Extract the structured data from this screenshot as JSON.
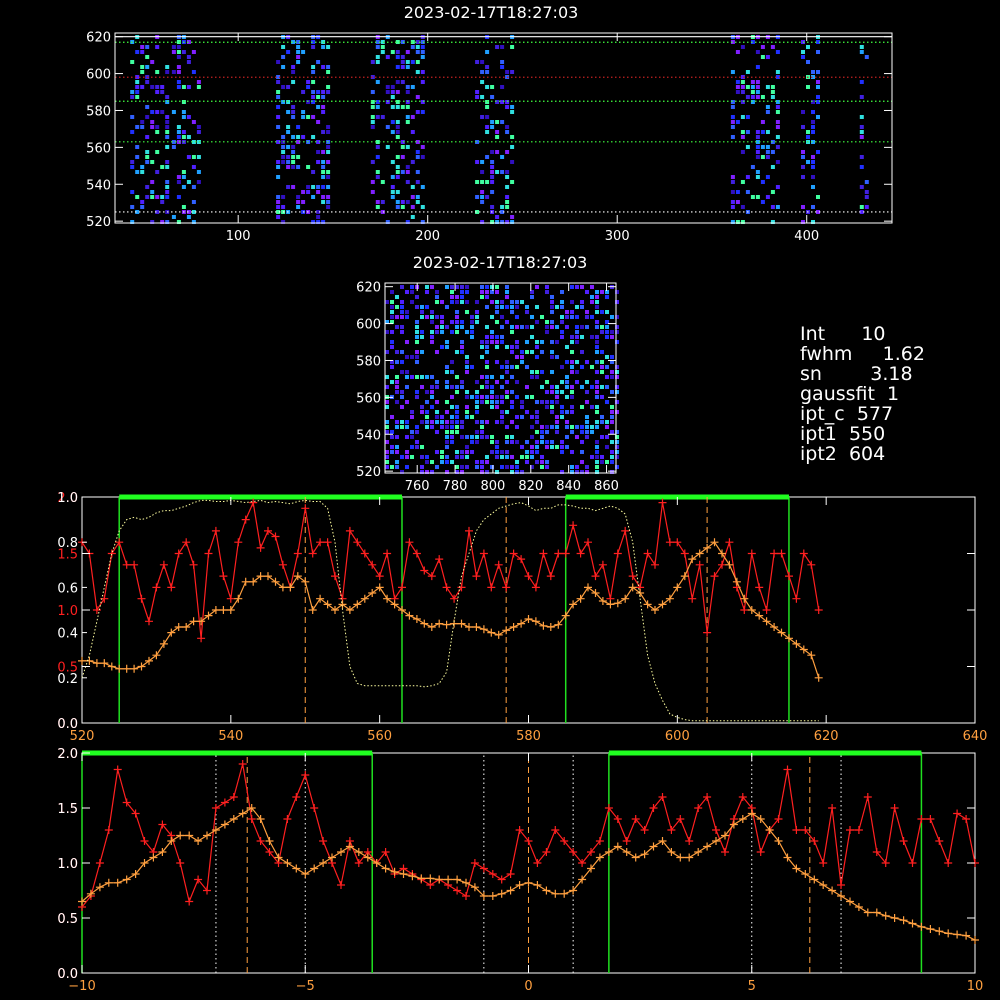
{
  "chart_data": [
    {
      "type": "heatmap",
      "title": "2023-02-17T18:27:03",
      "xlim": [
        35,
        445
      ],
      "ylim": [
        519,
        622
      ],
      "x_ticks": [
        100,
        200,
        300,
        400
      ],
      "y_ticks": [
        520,
        540,
        560,
        580,
        600,
        620
      ],
      "column_bands": [
        [
          43,
          62
        ],
        [
          65,
          80
        ],
        [
          120,
          147
        ],
        [
          170,
          198
        ],
        [
          225,
          245
        ],
        [
          360,
          385
        ],
        [
          397,
          405
        ],
        [
          428,
          432
        ]
      ],
      "overlay_lines": [
        {
          "y": 617,
          "color": "#40ff40",
          "style": "dotted"
        },
        {
          "y": 598,
          "color": "#c02020",
          "style": "dotted"
        },
        {
          "y": 585,
          "color": "#40ff40",
          "style": "dotted"
        },
        {
          "y": 563,
          "color": "#40ff40",
          "style": "dotted"
        },
        {
          "y": 525,
          "color": "#ffffff",
          "style": "dotted"
        },
        {
          "y": 620,
          "color": "#ffffff",
          "style": "solid"
        }
      ]
    },
    {
      "type": "heatmap",
      "title": "2023-02-17T18:27:03",
      "xlim": [
        743,
        865
      ],
      "ylim": [
        519,
        622
      ],
      "x_ticks": [
        760,
        780,
        800,
        820,
        840,
        860
      ],
      "y_ticks": [
        520,
        540,
        560,
        580,
        600,
        620
      ]
    },
    {
      "type": "line",
      "xlim": [
        520,
        640
      ],
      "ylim": [
        0,
        2
      ],
      "x_ticks": [
        520,
        540,
        560,
        580,
        600,
        620,
        640
      ],
      "y_ticks_left_red": [
        0.0,
        0.5,
        1.0,
        1.5,
        2.0
      ],
      "y_ticks_left_white": [
        0.0,
        0.2,
        0.4,
        0.6,
        0.8,
        1.0
      ],
      "series": [
        {
          "color": "#ff2020",
          "marker": "+",
          "x_start": 519,
          "step": 1,
          "values": [
            1.3,
            1.6,
            1.5,
            1.0,
            1.1,
            1.5,
            1.6,
            1.4,
            1.4,
            1.1,
            0.9,
            1.2,
            1.4,
            1.2,
            1.5,
            1.6,
            1.4,
            0.75,
            1.5,
            1.7,
            1.3,
            1.1,
            1.6,
            1.8,
            1.95,
            1.55,
            1.7,
            1.65,
            1.4,
            1.2,
            1.5,
            1.9,
            1.5,
            1.6,
            1.6,
            1.3,
            1.1,
            1.7,
            1.6,
            1.5,
            1.4,
            1.3,
            1.5,
            1.1,
            1.2,
            1.6,
            1.5,
            1.35,
            1.3,
            1.45,
            1.2,
            1.1,
            1.2,
            1.7,
            1.3,
            1.5,
            1.2,
            1.4,
            1.2,
            1.5,
            1.45,
            1.3,
            1.2,
            1.5,
            1.3,
            1.5,
            1.5,
            1.75,
            1.5,
            1.6,
            1.3,
            1.4,
            1.1,
            1.5,
            1.7,
            1.3,
            1.2,
            1.5,
            1.4,
            1.95,
            1.6,
            1.6,
            1.5,
            1.1,
            1.4,
            0.8,
            1.3,
            1.4,
            1.6,
            1.2,
            1.0,
            1.5,
            1.2,
            1.0,
            1.5,
            1.5,
            1.3,
            1.1,
            1.5,
            1.4,
            1.0
          ]
        },
        {
          "color": "#ffa040",
          "marker": "+",
          "x_start": 519,
          "step": 1,
          "values": [
            0.5,
            0.55,
            0.55,
            0.53,
            0.53,
            0.5,
            0.48,
            0.48,
            0.48,
            0.5,
            0.55,
            0.6,
            0.7,
            0.8,
            0.85,
            0.85,
            0.9,
            0.9,
            0.95,
            1.0,
            1.0,
            1.0,
            1.1,
            1.25,
            1.25,
            1.3,
            1.3,
            1.25,
            1.2,
            1.2,
            1.3,
            1.25,
            1.0,
            1.1,
            1.05,
            1.0,
            1.05,
            1.0,
            1.05,
            1.1,
            1.15,
            1.2,
            1.1,
            1.05,
            1.0,
            0.95,
            0.92,
            0.88,
            0.85,
            0.88,
            0.87,
            0.88,
            0.88,
            0.85,
            0.85,
            0.83,
            0.8,
            0.78,
            0.82,
            0.85,
            0.88,
            0.92,
            0.9,
            0.86,
            0.85,
            0.87,
            0.95,
            1.05,
            1.1,
            1.2,
            1.15,
            1.08,
            1.05,
            1.06,
            1.1,
            1.2,
            1.15,
            1.05,
            1.0,
            1.05,
            1.1,
            1.2,
            1.3,
            1.45,
            1.5,
            1.55,
            1.6,
            1.5,
            1.4,
            1.25,
            1.1,
            1.0,
            0.95,
            0.9,
            0.85,
            0.8,
            0.75,
            0.7,
            0.65,
            0.6,
            0.4
          ]
        },
        {
          "color": "#ffffa0",
          "style": "dotted",
          "x_start": 519,
          "step": 1,
          "values": [
            0.25,
            0.4,
            0.6,
            0.9,
            1.2,
            1.5,
            1.7,
            1.8,
            1.82,
            1.8,
            1.82,
            1.86,
            1.88,
            1.88,
            1.9,
            1.92,
            1.95,
            1.97,
            1.97,
            1.96,
            1.96,
            1.97,
            1.96,
            1.95,
            1.96,
            1.97,
            1.95,
            1.96,
            1.95,
            1.94,
            1.96,
            1.97,
            1.96,
            1.96,
            1.9,
            1.6,
            1.0,
            0.5,
            0.35,
            0.33,
            0.33,
            0.33,
            0.33,
            0.33,
            0.33,
            0.33,
            0.33,
            0.32,
            0.33,
            0.35,
            0.45,
            0.9,
            1.3,
            1.5,
            1.7,
            1.8,
            1.85,
            1.9,
            1.92,
            1.94,
            1.95,
            1.92,
            1.88,
            1.9,
            1.9,
            1.93,
            1.93,
            1.92,
            1.9,
            1.9,
            1.88,
            1.9,
            1.92,
            1.9,
            1.85,
            1.6,
            1.1,
            0.6,
            0.35,
            0.2,
            0.08,
            0.05,
            0.03,
            0.02,
            0.02,
            0.02,
            0.02,
            0.02,
            0.02,
            0.02,
            0.02,
            0.02,
            0.02,
            0.02,
            0.02,
            0.02,
            0.02,
            0.02,
            0.02,
            0.02,
            0.02
          ]
        }
      ],
      "green_boxes": [
        [
          525,
          563
        ],
        [
          585,
          615
        ]
      ],
      "orange_dashed_x": [
        550,
        577,
        604
      ]
    },
    {
      "type": "line",
      "xlim": [
        -10,
        10
      ],
      "ylim": [
        0,
        2
      ],
      "x_ticks": [
        -10,
        -5,
        0,
        5,
        10
      ],
      "y_ticks_left_red": [
        0.0,
        0.5,
        1.0,
        1.5,
        2.0
      ],
      "y_ticks_left_white": [
        0.0,
        0.5,
        1.0,
        1.5,
        2.0
      ],
      "series": [
        {
          "color": "#ff2020",
          "marker": "+",
          "x_start": -10,
          "step": 0.2,
          "values": [
            0.6,
            0.7,
            1.0,
            1.3,
            1.85,
            1.55,
            1.45,
            1.2,
            1.1,
            1.35,
            1.25,
            1.0,
            0.65,
            0.85,
            0.75,
            1.5,
            1.55,
            1.6,
            1.9,
            1.4,
            1.2,
            1.1,
            1.0,
            1.4,
            1.6,
            1.8,
            1.5,
            1.2,
            1.0,
            0.8,
            1.2,
            1.0,
            1.1,
            1.0,
            1.1,
            0.9,
            0.95,
            0.9,
            0.85,
            0.8,
            0.85,
            0.8,
            0.75,
            0.7,
            1.0,
            0.95,
            0.9,
            0.85,
            0.9,
            1.3,
            1.2,
            1.0,
            1.1,
            1.3,
            1.2,
            1.1,
            1.0,
            1.1,
            1.2,
            1.5,
            1.4,
            1.2,
            1.4,
            1.3,
            1.5,
            1.6,
            1.3,
            1.4,
            1.2,
            1.5,
            1.6,
            1.3,
            1.1,
            1.4,
            1.6,
            1.5,
            1.1,
            1.3,
            1.4,
            1.85,
            1.3,
            1.3,
            1.2,
            1.0,
            1.5,
            0.8,
            1.3,
            1.3,
            1.6,
            1.1,
            1.0,
            1.5,
            1.2,
            1.0,
            1.4,
            1.4,
            1.2,
            1.0,
            1.45,
            1.4,
            1.0
          ]
        },
        {
          "color": "#ffa040",
          "marker": "+",
          "x_start": -10,
          "step": 0.2,
          "values": [
            0.65,
            0.72,
            0.78,
            0.82,
            0.82,
            0.85,
            0.9,
            1.0,
            1.05,
            1.1,
            1.2,
            1.25,
            1.25,
            1.2,
            1.25,
            1.3,
            1.35,
            1.4,
            1.45,
            1.5,
            1.4,
            1.2,
            1.05,
            1.0,
            0.95,
            0.9,
            0.95,
            1.0,
            1.05,
            1.1,
            1.15,
            1.1,
            1.05,
            1.0,
            0.95,
            0.92,
            0.9,
            0.88,
            0.86,
            0.86,
            0.85,
            0.85,
            0.85,
            0.82,
            0.78,
            0.7,
            0.7,
            0.72,
            0.75,
            0.8,
            0.82,
            0.8,
            0.75,
            0.72,
            0.72,
            0.75,
            0.85,
            0.95,
            1.05,
            1.1,
            1.15,
            1.1,
            1.05,
            1.08,
            1.15,
            1.2,
            1.1,
            1.05,
            1.05,
            1.1,
            1.15,
            1.2,
            1.25,
            1.35,
            1.4,
            1.45,
            1.4,
            1.3,
            1.2,
            1.05,
            0.95,
            0.9,
            0.85,
            0.8,
            0.75,
            0.7,
            0.65,
            0.6,
            0.55,
            0.55,
            0.52,
            0.5,
            0.48,
            0.45,
            0.42,
            0.4,
            0.38,
            0.36,
            0.35,
            0.34,
            0.3
          ]
        }
      ],
      "green_boxes": [
        [
          -10,
          -3.5
        ],
        [
          1.8,
          8.8
        ]
      ],
      "orange_dashed_x": [
        -6.3,
        0.0,
        6.3
      ],
      "white_dotted_x": [
        -7.0,
        -5.0,
        -1.0,
        1.0,
        5.0,
        7.0
      ]
    }
  ],
  "info_panel": {
    "lines": [
      "Int      10",
      "fwhm     1.62",
      "sn        3.18",
      "gaussfit  1",
      "ipt_c  577",
      "ipt1  550",
      "ipt2  604"
    ]
  }
}
